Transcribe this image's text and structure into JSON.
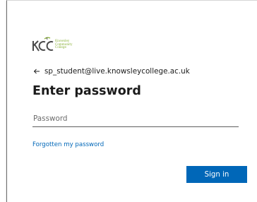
{
  "logo": {
    "mark": "KC",
    "line1": "Knowsley",
    "line2": "Community",
    "line3": "College",
    "mark_color": "#4a4a4a",
    "accent_color": "#8bb23a"
  },
  "identity": {
    "back_icon": "arrow-left-icon",
    "email": "sp_student@live.knowsleycollege.ac.uk"
  },
  "page": {
    "title": "Enter password"
  },
  "password": {
    "placeholder": "Password",
    "value": ""
  },
  "links": {
    "forgot": "Forgotten my password"
  },
  "buttons": {
    "sign_in": "Sign in",
    "sign_in_color": "#0067b8"
  }
}
